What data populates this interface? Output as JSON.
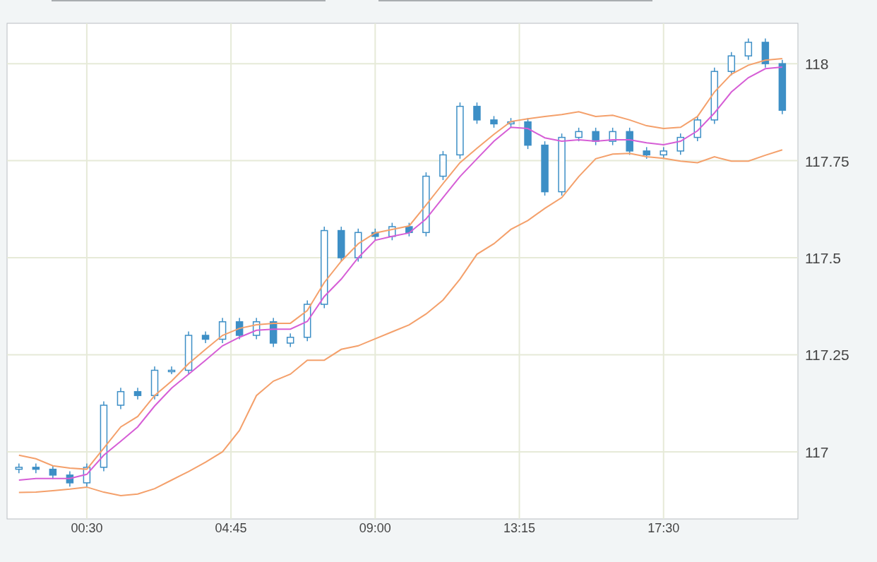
{
  "chart": {
    "chart_data": {
      "type": "candlestick",
      "grid": true,
      "xlim": [
        -1.85,
        21.46
      ],
      "ylim": [
        116.827,
        118.104
      ],
      "xticks": [
        {
          "value": 0.5,
          "label": "00:30"
        },
        {
          "value": 4.75,
          "label": "04:45"
        },
        {
          "value": 9,
          "label": "09:00"
        },
        {
          "value": 13.25,
          "label": "13:15"
        },
        {
          "value": 17.5,
          "label": "17:30"
        }
      ],
      "yticks": [
        {
          "value": 117,
          "label": "117"
        },
        {
          "value": 117.25,
          "label": "117.25"
        },
        {
          "value": 117.5,
          "label": "117.5"
        },
        {
          "value": 117.75,
          "label": "117.75"
        },
        {
          "value": 118,
          "label": "118"
        }
      ],
      "x": [
        -1.5,
        -1,
        -0.5,
        0,
        0.5,
        1,
        1.5,
        2,
        2.5,
        3,
        3.5,
        4,
        4.5,
        5,
        5.5,
        6,
        6.5,
        7,
        7.5,
        8,
        8.5,
        9,
        9.5,
        10,
        10.5,
        11,
        11.5,
        12,
        12.5,
        13,
        13.5,
        14,
        14.5,
        15,
        15.5,
        16,
        16.5,
        17,
        17.5,
        18,
        18.5,
        19,
        19.5,
        20,
        20.5,
        21
      ],
      "ohlc": [
        [
          116.955,
          116.97,
          116.945,
          116.96
        ],
        [
          116.96,
          116.97,
          116.945,
          116.955
        ],
        [
          116.955,
          116.965,
          116.93,
          116.94
        ],
        [
          116.94,
          116.95,
          116.91,
          116.92
        ],
        [
          116.92,
          116.97,
          116.91,
          116.96
        ],
        [
          116.96,
          117.13,
          116.95,
          117.12
        ],
        [
          117.12,
          117.165,
          117.11,
          117.155
        ],
        [
          117.155,
          117.165,
          117.135,
          117.145
        ],
        [
          117.145,
          117.22,
          117.135,
          117.21
        ],
        [
          117.21,
          117.22,
          117.2,
          117.21
        ],
        [
          117.21,
          117.31,
          117.2,
          117.3
        ],
        [
          117.3,
          117.31,
          117.28,
          117.29
        ],
        [
          117.29,
          117.345,
          117.28,
          117.335
        ],
        [
          117.335,
          117.345,
          117.29,
          117.3
        ],
        [
          117.3,
          117.345,
          117.29,
          117.335
        ],
        [
          117.335,
          117.345,
          117.27,
          117.28
        ],
        [
          117.28,
          117.305,
          117.27,
          117.295
        ],
        [
          117.295,
          117.39,
          117.285,
          117.38
        ],
        [
          117.38,
          117.58,
          117.37,
          117.57
        ],
        [
          117.57,
          117.58,
          117.49,
          117.5
        ],
        [
          117.5,
          117.575,
          117.49,
          117.565
        ],
        [
          117.565,
          117.575,
          117.545,
          117.555
        ],
        [
          117.555,
          117.59,
          117.545,
          117.58
        ],
        [
          117.58,
          117.59,
          117.555,
          117.565
        ],
        [
          117.565,
          117.72,
          117.555,
          117.71
        ],
        [
          117.71,
          117.775,
          117.7,
          117.765
        ],
        [
          117.765,
          117.9,
          117.755,
          117.89
        ],
        [
          117.89,
          117.9,
          117.845,
          117.855
        ],
        [
          117.855,
          117.865,
          117.835,
          117.845
        ],
        [
          117.845,
          117.86,
          117.835,
          117.85
        ],
        [
          117.85,
          117.86,
          117.78,
          117.79
        ],
        [
          117.79,
          117.8,
          117.66,
          117.67
        ],
        [
          117.67,
          117.82,
          117.66,
          117.81
        ],
        [
          117.81,
          117.835,
          117.8,
          117.825
        ],
        [
          117.825,
          117.835,
          117.79,
          117.8
        ],
        [
          117.8,
          117.835,
          117.79,
          117.825
        ],
        [
          117.825,
          117.835,
          117.765,
          117.775
        ],
        [
          117.775,
          117.785,
          117.755,
          117.765
        ],
        [
          117.765,
          117.785,
          117.755,
          117.775
        ],
        [
          117.775,
          117.82,
          117.765,
          117.81
        ],
        [
          117.81,
          117.865,
          117.8,
          117.855
        ],
        [
          117.855,
          117.99,
          117.845,
          117.98
        ],
        [
          117.98,
          118.03,
          117.97,
          118.02
        ],
        [
          118.02,
          118.065,
          118.01,
          118.055
        ],
        [
          118.055,
          118.065,
          117.99,
          118.0
        ],
        [
          118.0,
          118.01,
          117.87,
          117.88
        ]
      ],
      "series": [
        {
          "type": "line",
          "color": "#d65ed6",
          "values": [
            116.927,
            116.931,
            116.931,
            116.931,
            116.942,
            116.991,
            117.027,
            117.064,
            117.118,
            117.164,
            117.2,
            117.236,
            117.273,
            117.295,
            117.313,
            117.316,
            117.316,
            117.336,
            117.4,
            117.445,
            117.5,
            117.545,
            117.555,
            117.564,
            117.6,
            117.655,
            117.709,
            117.755,
            117.8,
            117.836,
            117.833,
            117.809,
            117.8,
            117.804,
            117.8,
            117.804,
            117.804,
            117.796,
            117.791,
            117.8,
            117.827,
            117.873,
            117.927,
            117.964,
            117.987,
            117.991
          ]
        },
        {
          "type": "line",
          "color": "#f4a06b",
          "values": [
            116.991,
            116.982,
            116.964,
            116.958,
            116.955,
            117.009,
            117.064,
            117.091,
            117.145,
            117.182,
            117.227,
            117.264,
            117.3,
            117.318,
            117.327,
            117.331,
            117.331,
            117.364,
            117.436,
            117.491,
            117.536,
            117.564,
            117.573,
            117.582,
            117.636,
            117.691,
            117.745,
            117.782,
            117.818,
            117.851,
            117.858,
            117.864,
            117.869,
            117.876,
            117.864,
            117.867,
            117.855,
            117.84,
            117.833,
            117.836,
            117.864,
            117.927,
            117.973,
            117.996,
            118.009,
            118.013
          ]
        },
        {
          "type": "line",
          "color": "#f4a06b",
          "values": [
            116.895,
            116.896,
            116.9,
            116.904,
            116.909,
            116.896,
            116.887,
            116.891,
            116.905,
            116.927,
            116.949,
            116.973,
            117.0,
            117.055,
            117.145,
            117.182,
            117.2,
            117.236,
            117.236,
            117.264,
            117.273,
            117.291,
            117.309,
            117.327,
            117.355,
            117.391,
            117.445,
            117.509,
            117.536,
            117.573,
            117.596,
            117.627,
            117.655,
            117.709,
            117.755,
            117.767,
            117.769,
            117.76,
            117.756,
            117.749,
            117.745,
            117.76,
            117.749,
            117.749,
            117.764,
            117.778
          ]
        }
      ]
    }
  }
}
